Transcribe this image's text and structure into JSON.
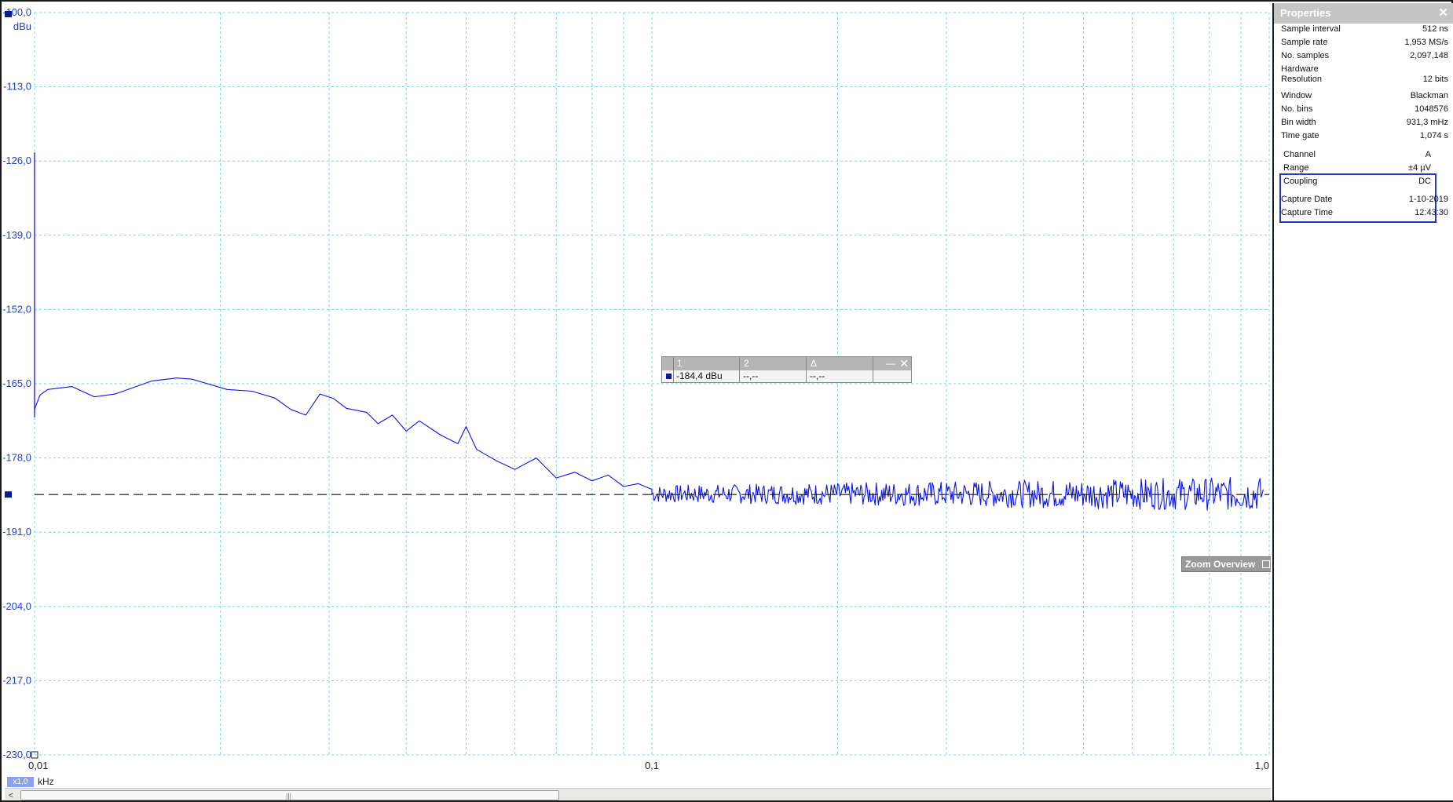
{
  "chart_data": {
    "type": "line",
    "title": "",
    "ylabel": "dBu",
    "xlabel": "kHz",
    "x_scale": "log",
    "xlim": [
      0.01,
      1.0
    ],
    "ylim": [
      -230.0,
      -100.0
    ],
    "y_tick_labels": [
      "-100,0",
      "-113,0",
      "-126,0",
      "-139,0",
      "-152,0",
      "-165,0",
      "-178,0",
      "-191,0",
      "-204,0",
      "-217,0",
      "-230,0"
    ],
    "y_ticks": [
      -100,
      -113,
      -126,
      -139,
      -152,
      -165,
      -178,
      -191,
      -204,
      -217,
      -230
    ],
    "x_tick_labels": [
      "0,01",
      "0,1",
      "1,0"
    ],
    "x_ticks": [
      0.01,
      0.1,
      1.0
    ],
    "grid": true,
    "marker_level_dbu": -184.4,
    "series": [
      {
        "color": "#0a14e6",
        "x": [
          0.01,
          0.0102,
          0.0105,
          0.0115,
          0.0125,
          0.0135,
          0.0155,
          0.017,
          0.018,
          0.0205,
          0.0225,
          0.0245,
          0.026,
          0.0275,
          0.029,
          0.0305,
          0.032,
          0.0345,
          0.036,
          0.038,
          0.04,
          0.042,
          0.0455,
          0.0485,
          0.05,
          0.052,
          0.056,
          0.06,
          0.065,
          0.07,
          0.075,
          0.08,
          0.085,
          0.09,
          0.095,
          0.1
        ],
        "y": [
          -169.5,
          -167.0,
          -166.0,
          -165.5,
          -167.3,
          -166.8,
          -164.5,
          -164.0,
          -164.2,
          -166.0,
          -166.3,
          -167.5,
          -169.5,
          -170.5,
          -166.8,
          -167.6,
          -169.3,
          -170.0,
          -172.0,
          -170.5,
          -173.3,
          -171.5,
          -174.0,
          -175.5,
          -172.5,
          -176.5,
          -178.5,
          -180.0,
          -178.0,
          -181.5,
          -180.5,
          -182.0,
          -181.0,
          -183.0,
          -182.5,
          -183.5
        ]
      }
    ],
    "noise_band": {
      "x_from": 0.1,
      "x_to": 0.98,
      "center_dbu": -184.3,
      "peak_to_peak_db": 6.0,
      "color": "#0a14e6"
    }
  },
  "plot": {
    "unit_label": "dBu",
    "x_unit_label": "kHz",
    "zoom_badge": "x1,0",
    "scroll_left_glyph": "<",
    "scroll_grip": "|||",
    "colors": {
      "grid": "#7fd3d8",
      "trace": "#0a14e6",
      "axis_text": "#1f3fd0",
      "marker": "#0b1b8a"
    }
  },
  "measurements": {
    "col1": "1",
    "col2": "2",
    "col_delta": "Δ",
    "val1": "-184,4 dBu",
    "val2": "--,--",
    "val_delta": "--,--",
    "minimize_glyph": "—",
    "close_glyph": "✕"
  },
  "zoom_overview": {
    "label": "Zoom Overview"
  },
  "properties": {
    "title": "Properties",
    "close_glyph": "✕",
    "rows": [
      {
        "label": "Sample interval",
        "value": "512 ns"
      },
      {
        "label": "Sample rate",
        "value": "1,953 MS/s"
      },
      {
        "label": "No. samples",
        "value": "2,097,148"
      },
      {
        "label": "Hardware",
        "value": ""
      },
      {
        "label": "Resolution",
        "value": "12 bits"
      },
      {
        "label": "Window",
        "value": "Blackman"
      },
      {
        "label": "No. bins",
        "value": "1048576"
      },
      {
        "label": "Bin width",
        "value": "931,3 mHz"
      },
      {
        "label": "Time gate",
        "value": "1,074 s"
      },
      {
        "label": "Channel",
        "value": "A"
      },
      {
        "label": "Range",
        "value": "±4 µV"
      },
      {
        "label": "Coupling",
        "value": "DC"
      },
      {
        "label": "Capture Date",
        "value": "1-10-2019"
      },
      {
        "label": "Capture Time",
        "value": "12:43:30"
      }
    ]
  }
}
